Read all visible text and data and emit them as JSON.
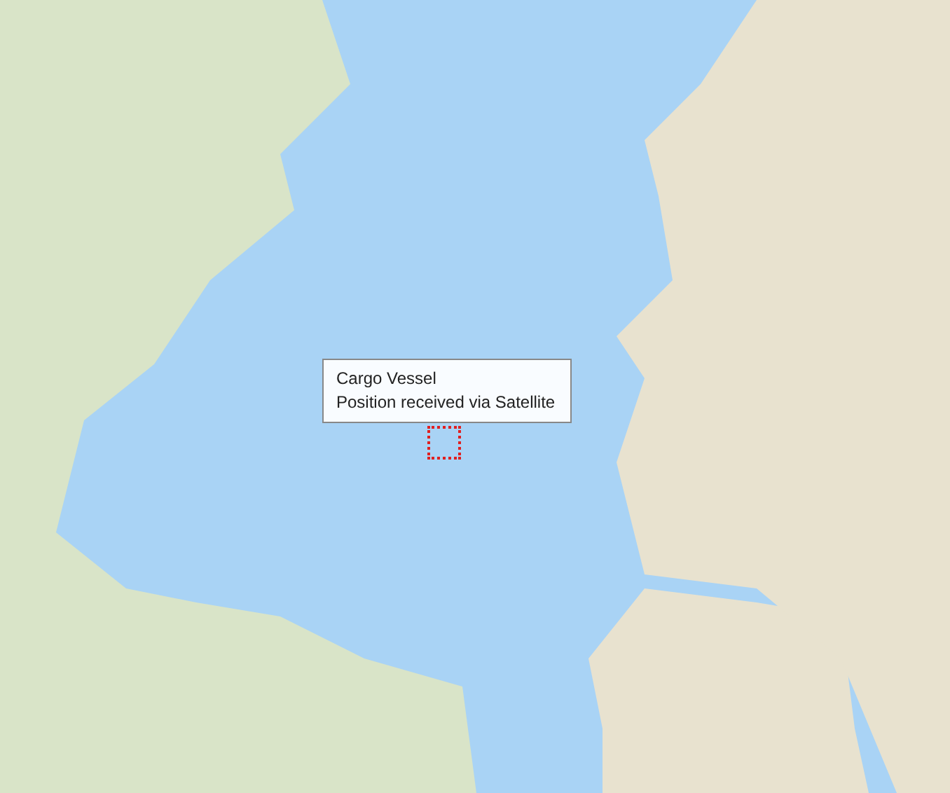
{
  "tooltip": {
    "title": "Cargo Vessel",
    "detail": "Position received via Satellite"
  }
}
